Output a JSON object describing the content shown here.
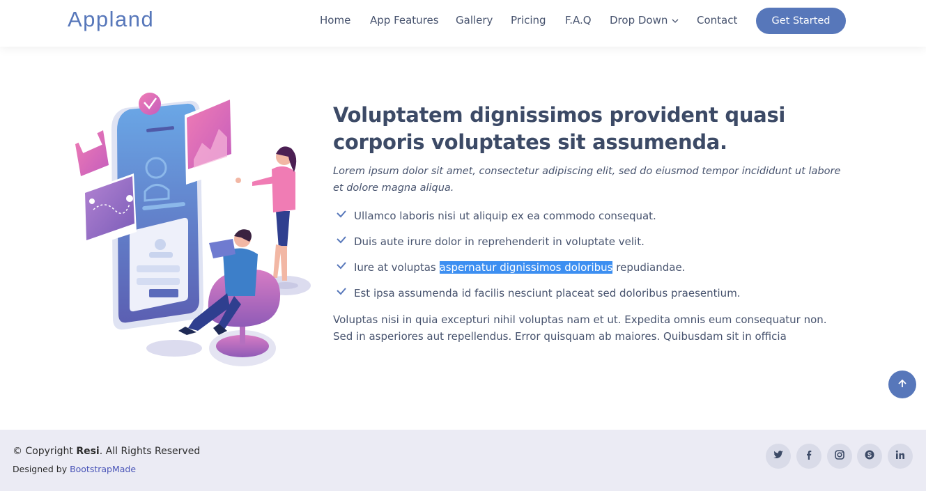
{
  "header": {
    "logo": "Appland",
    "nav": [
      {
        "label": "Home"
      },
      {
        "label": "App Features"
      },
      {
        "label": "Gallery"
      },
      {
        "label": "Pricing"
      },
      {
        "label": "F.A.Q"
      },
      {
        "label": "Drop Down"
      },
      {
        "label": "Contact"
      }
    ],
    "cta_label": "Get Started"
  },
  "main": {
    "title_line1": "Voluptatem dignissimos provident quasi",
    "title_line2": "corporis voluptates sit assumenda.",
    "lead": "Lorem ipsum dolor sit amet, consectetur adipiscing elit, sed do eiusmod tempor incididunt ut labore et dolore magna aliqua.",
    "checklist": [
      {
        "text": "Ullamco laboris nisi ut aliquip ex ea commodo consequat."
      },
      {
        "text": "Duis aute irure dolor in reprehenderit in voluptate velit."
      },
      {
        "before": "Iure at voluptas ",
        "selected": "aspernatur dignissimos doloribus",
        "after": " repudiandae."
      },
      {
        "text": "Est ipsa assumenda id facilis nesciunt placeat sed doloribus praesentium."
      }
    ],
    "paragraph": "Voluptas nisi in quia excepturi nihil voluptas nam et ut. Expedita omnis eum consequatur non. Sed in asperiores aut repellendus. Error quisquam ab maiores. Quibusdam sit in officia"
  },
  "footer": {
    "copyright_prefix": "© Copyright ",
    "copyright_brand": "Resi",
    "copyright_suffix": ". All Rights Reserved",
    "credits_prefix": "Designed by ",
    "credits_link": "BootstrapMade",
    "social": [
      "twitter-icon",
      "facebook-icon",
      "instagram-icon",
      "skype-icon",
      "linkedin-icon"
    ]
  },
  "colors": {
    "accent": "#5777ba",
    "heading": "#3c4a66",
    "selection": "#3d8ff1",
    "footer_bg": "#ebebf4"
  }
}
